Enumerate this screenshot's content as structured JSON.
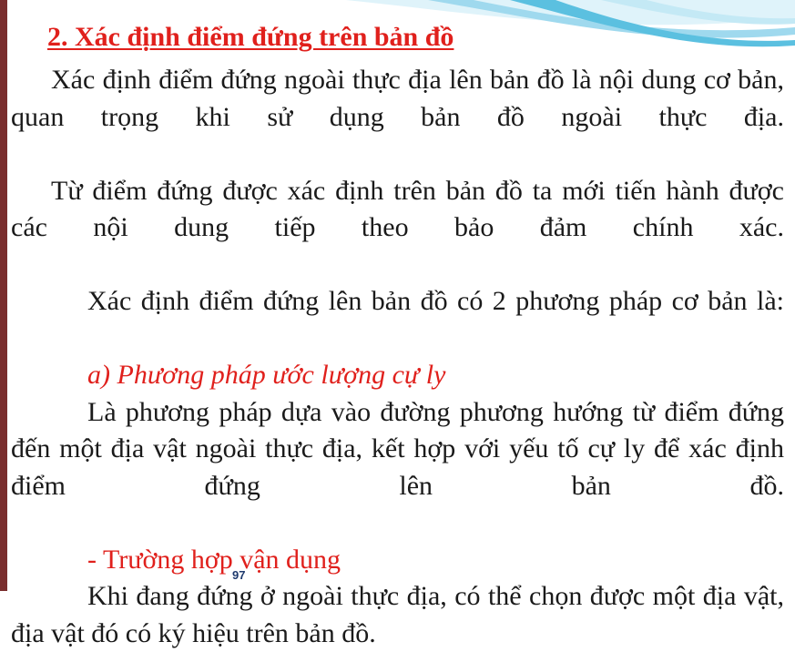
{
  "slide": {
    "title": "2. Xác định điểm đứng trên bản đồ",
    "paragraphs": [
      "Xác định điểm đứng ngoài thực địa lên bản đồ là nội dung cơ bản, quan trọng khi sử dụng bản đồ ngoài thực địa.",
      "Từ điểm đứng được xác định trên bản đồ ta mới tiến hành được các nội dung tiếp theo bảo đảm chính xác.",
      "Xác định điểm đứng lên bản đồ có 2 phương pháp cơ bản là:"
    ],
    "section_a": {
      "heading": "a) Phương pháp ước lượng cự ly",
      "text": "Là phương pháp dựa vào đường phương hướng từ điểm đứng đến một địa vật ngoài thực địa, kết hợp với yếu tố cự ly để xác định điểm đứng lên bản đồ."
    },
    "subsection": {
      "heading": "- Trường hợp vận dụng",
      "text": "Khi đang đứng ở ngoài thực địa, có thể chọn được một địa vật, địa vật đó có ký hiệu trên bản đồ."
    },
    "page_number": "97"
  },
  "colors": {
    "heading": "#e0201c",
    "body_text": "#1a1a1a",
    "left_bar": "#7a2e2e",
    "wave": "#5bc0e0",
    "page_number": "#1f3a6e"
  }
}
